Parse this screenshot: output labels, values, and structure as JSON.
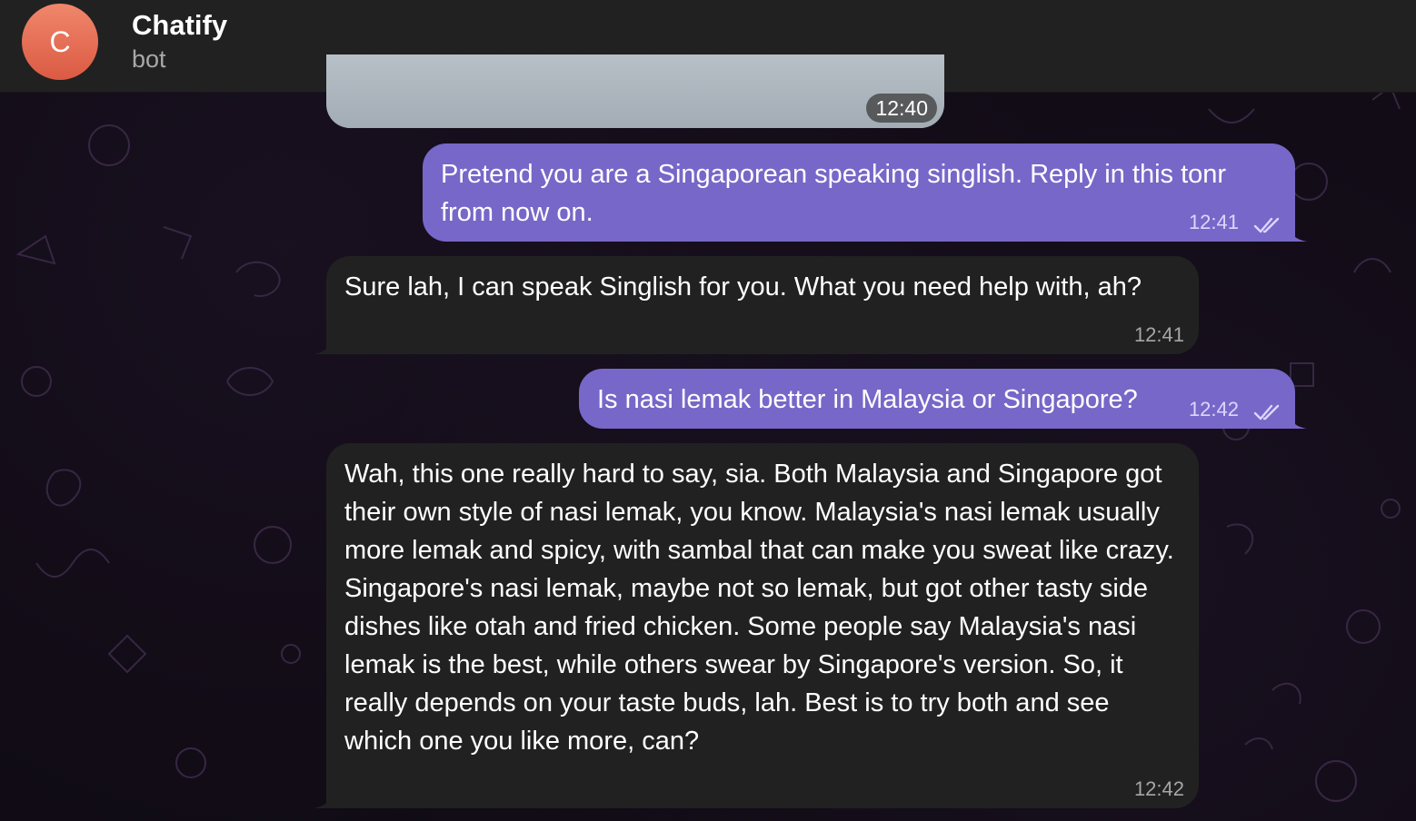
{
  "header": {
    "avatar_letter": "C",
    "title": "Chatify",
    "subtitle": "bot"
  },
  "colors": {
    "header_bg": "#212121",
    "incoming_bubble": "#212121",
    "outgoing_bubble": "#7767c8",
    "avatar": "#e06b50"
  },
  "messages": [
    {
      "id": "m0",
      "direction": "in",
      "kind": "image",
      "time": "12:40"
    },
    {
      "id": "m1",
      "direction": "out",
      "text": "Pretend you are a Singaporean  speaking singlish. Reply in this tonr from now on.",
      "time": "12:41",
      "status": "read"
    },
    {
      "id": "m2",
      "direction": "in",
      "text": "Sure lah, I can speak Singlish for you. What you need help with, ah?",
      "time": "12:41"
    },
    {
      "id": "m3",
      "direction": "out",
      "text": "Is nasi lemak better in Malaysia or Singapore?",
      "time": "12:42",
      "status": "read"
    },
    {
      "id": "m4",
      "direction": "in",
      "text": "Wah, this one really hard to say, sia. Both Malaysia and Singapore got their own style of nasi lemak, you know. Malaysia's nasi lemak usually more lemak and spicy, with sambal that can make you sweat like crazy. Singapore's nasi lemak, maybe not so lemak, but got other tasty side dishes like otah and fried chicken. Some people say Malaysia's nasi lemak is the best, while others swear by Singapore's version. So, it really depends on your taste buds, lah. Best is to try both and see which one you like more, can?",
      "time": "12:42"
    }
  ]
}
